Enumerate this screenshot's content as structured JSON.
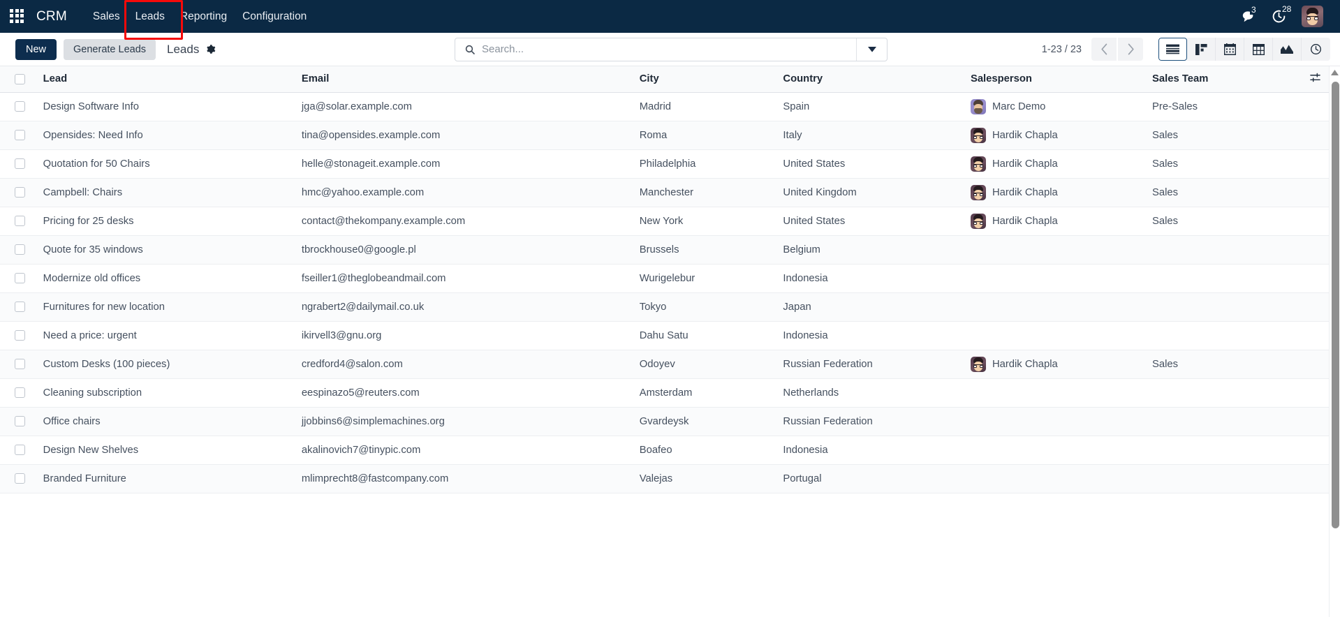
{
  "navbar": {
    "apps_icon": "apps-grid-icon",
    "brand": "CRM",
    "menus": [
      {
        "label": "Sales"
      },
      {
        "label": "Leads",
        "highlighted": true
      },
      {
        "label": "Reporting"
      },
      {
        "label": "Configuration"
      }
    ],
    "messages_icon": "messages-icon",
    "messages_count": "3",
    "activities_icon": "clock-activity-icon",
    "activities_count": "28",
    "avatar": "user-avatar",
    "background_color": "#0b2944",
    "annotation_color": "#f60a0a"
  },
  "control_panel": {
    "new_label": "New",
    "generate_label": "Generate Leads",
    "breadcrumb": "Leads",
    "gear_icon": "gear-icon",
    "search": {
      "icon": "search-icon",
      "value": "",
      "placeholder": "Search...",
      "toggle_icon": "chevron-down-icon"
    },
    "pager": {
      "counter": "1-23 / 23",
      "prev_icon": "chevron-left-icon",
      "next_icon": "chevron-right-icon"
    },
    "views": [
      {
        "name": "list",
        "icon": "list-view-icon",
        "active": true
      },
      {
        "name": "kanban",
        "icon": "kanban-view-icon",
        "active": false
      },
      {
        "name": "calendar",
        "icon": "calendar-view-icon",
        "active": false
      },
      {
        "name": "pivot",
        "icon": "pivot-view-icon",
        "active": false
      },
      {
        "name": "graph",
        "icon": "graph-view-icon",
        "active": false
      },
      {
        "name": "activity",
        "icon": "activity-view-icon",
        "active": false
      }
    ]
  },
  "table": {
    "columns": [
      "Lead",
      "Email",
      "City",
      "Country",
      "Salesperson",
      "Sales Team"
    ],
    "optional_columns_icon": "sliders-icon",
    "rows": [
      {
        "lead": "Design Software Info",
        "email": "jga@solar.example.com",
        "city": "Madrid",
        "country": "Spain",
        "salesperson": "Marc Demo",
        "avatar": "a-marc",
        "team": "Pre-Sales"
      },
      {
        "lead": "Opensides: Need Info",
        "email": "tina@opensides.example.com",
        "city": "Roma",
        "country": "Italy",
        "salesperson": "Hardik Chapla",
        "avatar": "a-hardik",
        "team": "Sales"
      },
      {
        "lead": "Quotation for 50 Chairs",
        "email": "helle@stonageit.example.com",
        "city": "Philadelphia",
        "country": "United States",
        "salesperson": "Hardik Chapla",
        "avatar": "a-hardik",
        "team": "Sales"
      },
      {
        "lead": "Campbell: Chairs",
        "email": "hmc@yahoo.example.com",
        "city": "Manchester",
        "country": "United Kingdom",
        "salesperson": "Hardik Chapla",
        "avatar": "a-hardik",
        "team": "Sales"
      },
      {
        "lead": "Pricing for 25 desks",
        "email": "contact@thekompany.example.com",
        "city": "New York",
        "country": "United States",
        "salesperson": "Hardik Chapla",
        "avatar": "a-hardik",
        "team": "Sales"
      },
      {
        "lead": "Quote for 35 windows",
        "email": "tbrockhouse0@google.pl",
        "city": "Brussels",
        "country": "Belgium",
        "salesperson": "",
        "avatar": "",
        "team": ""
      },
      {
        "lead": "Modernize old offices",
        "email": "fseiller1@theglobeandmail.com",
        "city": "Wurigelebur",
        "country": "Indonesia",
        "salesperson": "",
        "avatar": "",
        "team": ""
      },
      {
        "lead": "Furnitures for new location",
        "email": "ngrabert2@dailymail.co.uk",
        "city": "Tokyo",
        "country": "Japan",
        "salesperson": "",
        "avatar": "",
        "team": ""
      },
      {
        "lead": "Need a price: urgent",
        "email": "ikirvell3@gnu.org",
        "city": "Dahu Satu",
        "country": "Indonesia",
        "salesperson": "",
        "avatar": "",
        "team": ""
      },
      {
        "lead": "Custom Desks (100 pieces)",
        "email": "credford4@salon.com",
        "city": "Odoyev",
        "country": "Russian Federation",
        "salesperson": "Hardik Chapla",
        "avatar": "a-hardik",
        "team": "Sales"
      },
      {
        "lead": "Cleaning subscription",
        "email": "eespinazo5@reuters.com",
        "city": "Amsterdam",
        "country": "Netherlands",
        "salesperson": "",
        "avatar": "",
        "team": ""
      },
      {
        "lead": "Office chairs",
        "email": "jjobbins6@simplemachines.org",
        "city": "Gvardeysk",
        "country": "Russian Federation",
        "salesperson": "",
        "avatar": "",
        "team": ""
      },
      {
        "lead": "Design New Shelves",
        "email": "akalinovich7@tinypic.com",
        "city": "Boafeo",
        "country": "Indonesia",
        "salesperson": "",
        "avatar": "",
        "team": ""
      },
      {
        "lead": "Branded Furniture",
        "email": "mlimprecht8@fastcompany.com",
        "city": "Valejas",
        "country": "Portugal",
        "salesperson": "",
        "avatar": "",
        "team": ""
      }
    ]
  },
  "scrollbar": {
    "up_icon": "scroll-up-arrow-icon",
    "thumb": "scroll-thumb"
  }
}
